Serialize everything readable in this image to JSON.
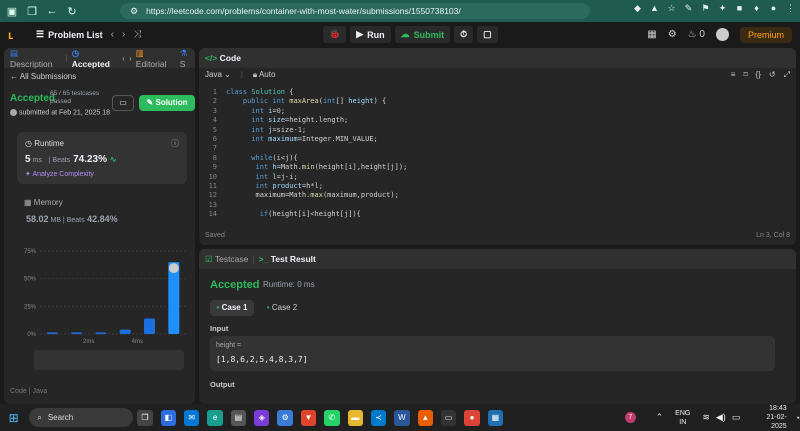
{
  "browser": {
    "url": "https://leetcode.com/problems/container-with-most-water/submissions/1550738103/"
  },
  "topnav": {
    "title": "Problem List",
    "run": "Run",
    "submit": "Submit",
    "fire_count": "0",
    "premium": "Premium"
  },
  "left": {
    "tabs": [
      "Description",
      "Accepted",
      "Editorial",
      "S"
    ],
    "all_submissions": "All Submissions",
    "status": "Accepted",
    "testcases": "65 / 65 testcases passed",
    "submitted": "submitted at Feb 21, 2025 18",
    "solution_btn": "Solution",
    "runtime_label": "Runtime",
    "runtime_value": "5",
    "runtime_unit": "ms",
    "beats_label": "Beats",
    "runtime_beats": "74.23%",
    "analyze": "Analyze Complexity",
    "memory_label": "Memory",
    "memory_value": "58.02",
    "memory_unit": "MB",
    "memory_beats": "42.84%",
    "bottom_label": "Code",
    "bottom_lang": "Java"
  },
  "chart_data": {
    "type": "bar",
    "ylim": [
      0,
      75
    ],
    "yticks": [
      "75%",
      "50%",
      "25%",
      "0%"
    ],
    "xticks": [
      "2ms",
      "4ms"
    ],
    "values": [
      1.5,
      1.5,
      1.5,
      4,
      14,
      65
    ],
    "highlight_index": 5
  },
  "editor": {
    "title": "Code",
    "lang": "Java",
    "mode": "Auto",
    "saved": "Saved",
    "cursor": "Ln 3, Col 8",
    "lines": [
      "class Solution {",
      "    public int maxArea(int[] height) {",
      "      int i=0;",
      "      int size=height.length;",
      "      int j=size-1;",
      "      int maximum=Integer.MIN_VALUE;",
      "",
      "      while(i<j){",
      "       int h=Math.min(height[i],height[j]);",
      "       int l=j-i;",
      "       int product=h*l;",
      "       maximum=Math.max(maximum,product);",
      "",
      "        if(height[i]<height[j]){"
    ]
  },
  "result": {
    "tab_testcase": "Testcase",
    "tab_result": "Test Result",
    "status": "Accepted",
    "runtime": "Runtime: 0 ms",
    "case1": "Case 1",
    "case2": "Case 2",
    "input_label": "Input",
    "param": "height =",
    "value": "[1,8,6,2,5,4,8,3,7]",
    "output_label": "Output"
  },
  "taskbar": {
    "search": "Search",
    "lang1": "ENG",
    "lang2": "IN",
    "time": "18:43",
    "date": "21-02-2025",
    "badge": "7"
  }
}
